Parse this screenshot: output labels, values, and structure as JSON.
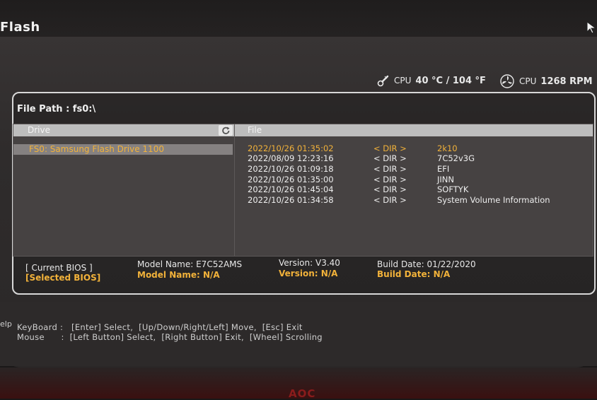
{
  "header": {
    "title": "Flash",
    "cpu_temp_label": "CPU",
    "cpu_temp_value": "40 °C / 104 °F",
    "cpu_fan_label": "CPU",
    "cpu_fan_value": "1268 RPM"
  },
  "file_path": "File Path : fs0:\\",
  "drive_panel": {
    "header": "Drive",
    "items": [
      {
        "label": "FS0: Samsung Flash Drive 1100",
        "selected": true
      }
    ]
  },
  "file_panel": {
    "header": "File",
    "rows": [
      {
        "date": "2022/10/26 01:35:02",
        "type": "< DIR >",
        "name": "2k10",
        "selected": true
      },
      {
        "date": "2022/08/09 12:23:16",
        "type": "< DIR >",
        "name": "7C52v3G",
        "selected": false
      },
      {
        "date": "2022/10/26 01:09:18",
        "type": "< DIR >",
        "name": "EFI",
        "selected": false
      },
      {
        "date": "2022/10/26 01:35:00",
        "type": "< DIR >",
        "name": "JINN",
        "selected": false
      },
      {
        "date": "2022/10/26 01:45:04",
        "type": "< DIR >",
        "name": "SOFTYK",
        "selected": false
      },
      {
        "date": "2022/10/26 01:34:58",
        "type": "< DIR >",
        "name": "System Volume Information",
        "selected": false
      }
    ]
  },
  "bios_info": {
    "current": {
      "label": "[ Current BIOS ]",
      "model": "Model Name: E7C52AMS",
      "version": "Version: V3.40",
      "build": "Build Date: 01/22/2020"
    },
    "selected": {
      "label": "[Selected BIOS]",
      "model": "Model Name: N/A",
      "version": "Version: N/A",
      "build": "Build Date: N/A"
    }
  },
  "help": {
    "title": "elp",
    "keyboard": "KeyBoard :   [Enter] Select,  [Up/Down/Right/Left] Move,  [Esc] Exit",
    "mouse": "Mouse      :  [Left Button] Select,  [Right Button] Exit,  [Wheel] Scrolling"
  },
  "brand": "AOC",
  "colors": {
    "accent": "#f2b23a",
    "panel": "#464242",
    "header_bar": "#bdbdbd",
    "text": "#e6e6e6",
    "brand": "#8a1c1c"
  }
}
